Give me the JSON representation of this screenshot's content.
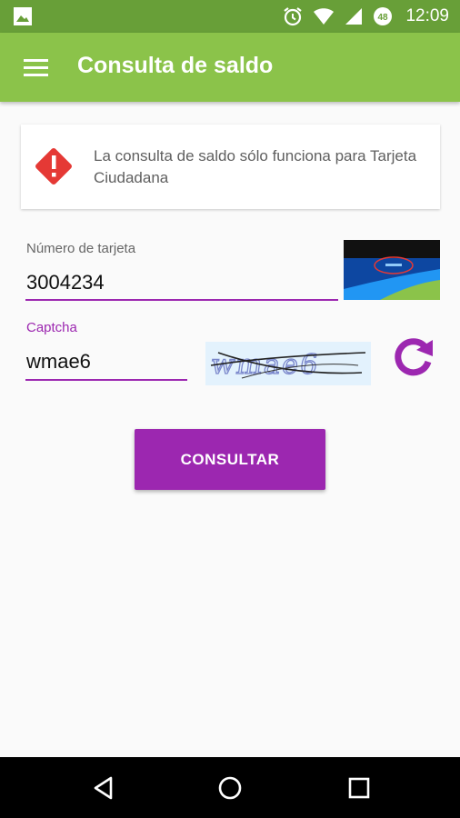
{
  "status_bar": {
    "time": "12:09",
    "icons": [
      "image-icon",
      "alarm-icon",
      "wifi-icon",
      "signal-icon",
      "battery-icon"
    ],
    "battery_text": "48"
  },
  "app_bar": {
    "title": "Consulta de saldo",
    "color": "#8bc34a"
  },
  "notice": {
    "icon": "warning-icon",
    "message": "La consulta de saldo sólo funciona para Tarjeta Ciudadana"
  },
  "card_number": {
    "label": "Número de tarjeta",
    "value": "3004234"
  },
  "captcha": {
    "label": "Captcha",
    "value": "wmae6",
    "refresh_icon": "refresh-icon"
  },
  "submit": {
    "label": "CONSULTAR",
    "color": "#9c27b0"
  },
  "nav_bar": {
    "icons": [
      "back-icon",
      "home-icon",
      "recents-icon"
    ]
  }
}
